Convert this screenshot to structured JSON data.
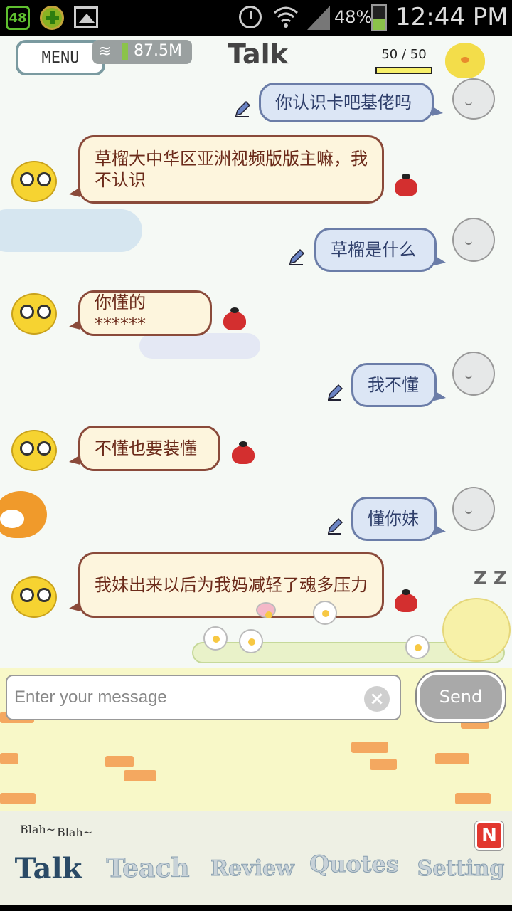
{
  "status_bar": {
    "badge": "48",
    "battery_percent": "48%",
    "time": "12:44 PM"
  },
  "header": {
    "menu_label": "MENU",
    "data_usage": "87.5M",
    "title": "Talk",
    "counter": "50 / 50"
  },
  "messages": [
    {
      "from": "user",
      "text": "你认识卡吧基佬吗"
    },
    {
      "from": "bot",
      "text": "草榴大中华区亚洲视频版版主嘛，我不认识"
    },
    {
      "from": "user",
      "text": "草榴是什么"
    },
    {
      "from": "bot",
      "text": "你懂的******"
    },
    {
      "from": "user",
      "text": "我不懂"
    },
    {
      "from": "bot",
      "text": "不懂也要装懂"
    },
    {
      "from": "user",
      "text": "懂你妹"
    },
    {
      "from": "bot",
      "text": "我妹出来以后为我妈减轻了魂多压力"
    }
  ],
  "input": {
    "placeholder": "Enter your message",
    "send_label": "Send"
  },
  "tabbar": {
    "blah1": "Blah~",
    "blah2": "Blah~",
    "tabs": [
      "Talk",
      "Teach",
      "Review",
      "Quotes",
      "Setting"
    ],
    "active_tab": "Talk",
    "badge": "N"
  },
  "decor": {
    "zz": "Z Z"
  },
  "colors": {
    "user_bubble": "#dce6f5",
    "bot_bubble": "#fdf5dd",
    "battery": "#8bc34a"
  }
}
